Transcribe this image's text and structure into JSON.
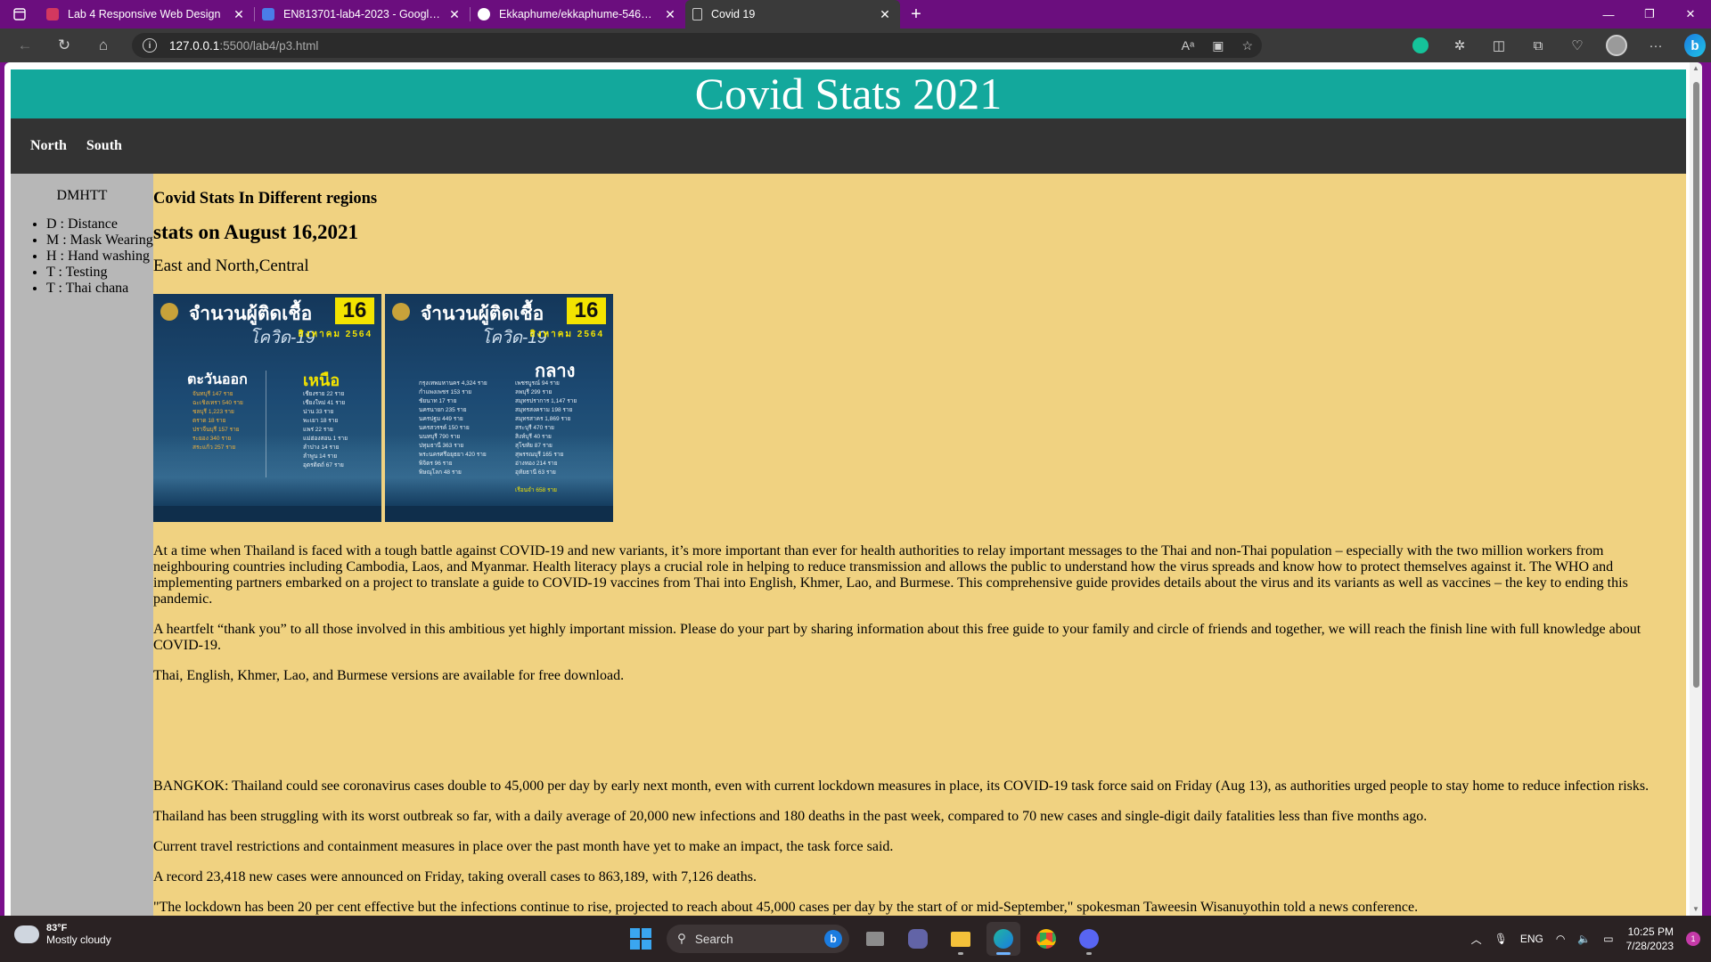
{
  "browser": {
    "tabs": [
      {
        "title": "Lab 4 Responsive Web Design",
        "icon": "slides-icon",
        "color": "#d3385f",
        "active": false
      },
      {
        "title": "EN813701-lab4-2023 - Google D",
        "icon": "docs-icon",
        "color": "#4a7de8",
        "active": false
      },
      {
        "title": "Ekkaphume/ekkaphume-5462-w",
        "icon": "github-icon",
        "color": "#ffffff",
        "active": false
      },
      {
        "title": "Covid 19",
        "icon": "page-icon",
        "color": "#cccccc",
        "active": true
      }
    ],
    "url_host": "127.0.0.1",
    "url_path": ":5500/lab4/p3.html"
  },
  "site": {
    "title": "Covid Stats 2021",
    "nav": [
      "North",
      "South"
    ],
    "aside": {
      "title": "DMHTT",
      "items": [
        "D : Distance",
        "M : Mask Wearing",
        "H : Hand washing",
        "T : Testing",
        "T : Thai chana"
      ]
    },
    "main": {
      "heading": "Covid Stats In Different regions",
      "date_heading": "stats on August 16,2021",
      "regions": "East and North,Central",
      "infographics": [
        {
          "header": "จำนวนผู้ติดเชื้อ",
          "subheader": "โควิด-19",
          "day": "16",
          "year": "สิงหาคม 2564",
          "left_region": "ตะวันออก",
          "right_region": "เหนือ",
          "left_rows": [
            "จันทบุรี  147 ราย",
            "ฉะเชิงเทรา  540 ราย",
            "ชลบุรี  1,223 ราย",
            "ตราด  18 ราย",
            "ปราจีนบุรี  157 ราย",
            "ระยอง  340 ราย",
            "สระแก้ว  257 ราย"
          ],
          "right_rows": [
            "เชียงราย  22 ราย",
            "เชียงใหม่  41 ราย",
            "น่าน  33 ราย",
            "พะเยา  18 ราย",
            "แพร่  22 ราย",
            "แม่ฮ่องสอน  1 ราย",
            "ลำปาง  14 ราย",
            "ลำพูน  14 ราย",
            "อุตรดิตถ์  67 ราย"
          ]
        },
        {
          "header": "จำนวนผู้ติดเชื้อ",
          "subheader": "โควิด-19",
          "day": "16",
          "year": "สิงหาคม 2564",
          "region": "กลาง",
          "left_rows": [
            "กรุงเทพมหานคร  4,324 ราย",
            "กำแพงเพชร  153 ราย",
            "ชัยนาท  17 ราย",
            "นครนายก  235 ราย",
            "นครปฐม  449 ราย",
            "นครสวรรค์  150 ราย",
            "นนทบุรี  790 ราย",
            "ปทุมธานี  363 ราย",
            "พระนครศรีอยุธยา  420 ราย",
            "พิจิตร  96 ราย",
            "พิษณุโลก  48 ราย"
          ],
          "right_rows": [
            "เพชรบูรณ์  94 ราย",
            "ลพบุรี  299 ราย",
            "สมุทรปราการ  1,147 ราย",
            "สมุทรสงคราม  198 ราย",
            "สมุทรสาคร  1,869 ราย",
            "สระบุรี  470 ราย",
            "สิงห์บุรี  40 ราย",
            "สุโขทัย  87 ราย",
            "สุพรรณบุรี  165 ราย",
            "อ่างทอง  214 ราย",
            "อุทัยธานี  63 ราย",
            "",
            "เรือนจำ  658 ราย"
          ]
        }
      ],
      "paragraphs_top": [
        "At a time when Thailand is faced with a tough battle against COVID-19 and new variants, it’s more important than ever for health authorities to relay important messages to the Thai and non-Thai population – especially with the two million workers from neighbouring countries including Cambodia, Laos, and Myanmar. Health literacy plays a crucial role in helping to reduce transmission and allows the public to understand how the virus spreads and know how to protect themselves against it. The WHO and implementing partners embarked on a project to translate a guide to COVID-19 vaccines from Thai into English, Khmer, Lao, and Burmese. This comprehensive guide provides details about the virus and its variants as well as vaccines – the key to ending this pandemic.",
        "A heartfelt “thank you” to all those involved in this ambitious yet highly important mission. Please do your part by sharing information about this free guide to your family and circle of friends and together, we will reach the finish line with full knowledge about COVID-19.",
        "Thai, English, Khmer, Lao, and Burmese versions are available for free download."
      ],
      "paragraphs_bottom": [
        "BANGKOK: Thailand could see coronavirus cases double to 45,000 per day by early next month, even with current lockdown measures in place, its COVID-19 task force said on Friday (Aug 13), as authorities urged people to stay home to reduce infection risks.",
        "Thailand has been struggling with its worst outbreak so far, with a daily average of 20,000 new infections and 180 deaths in the past week, compared to 70 new cases and single-digit daily fatalities less than five months ago.",
        "Current travel restrictions and containment measures in place over the past month have yet to make an impact, the task force said.",
        "A record 23,418 new cases were announced on Friday, taking overall cases to 863,189, with 7,126 deaths.",
        "\"The lockdown has been 20 per cent effective but the infections continue to rise, projected to reach about 45,000 cases per day by the start of or mid-September,\" spokesman Taweesin Wisanuyothin told a news conference."
      ]
    }
  },
  "taskbar": {
    "weather_temp": "83°F",
    "weather_desc": "Mostly cloudy",
    "search_label": "Search",
    "lang": "ENG",
    "time": "10:25 PM",
    "date": "7/28/2023",
    "notification_count": "1",
    "apps": [
      "task-view-icon",
      "teams-icon",
      "file-explorer-icon",
      "edge-icon",
      "chrome-icon",
      "discord-icon"
    ]
  }
}
